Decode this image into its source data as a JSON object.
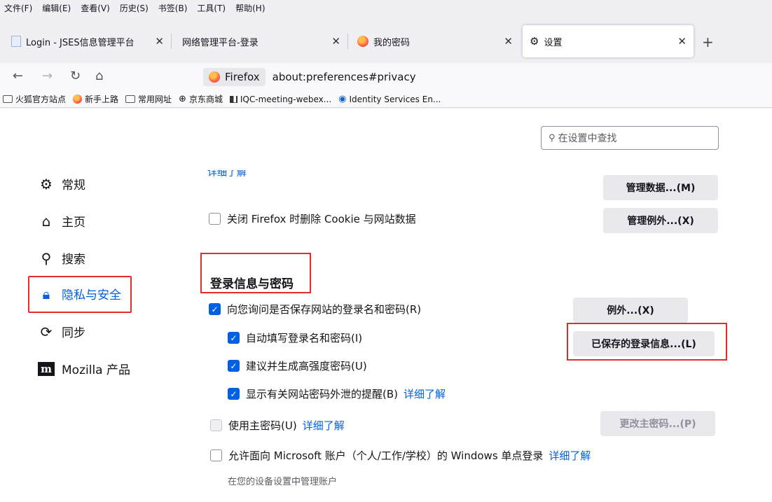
{
  "menubar": {
    "items": [
      "文件(F)",
      "编辑(E)",
      "查看(V)",
      "历史(S)",
      "书签(B)",
      "工具(T)",
      "帮助(H)"
    ]
  },
  "tabs": [
    {
      "title": "Login - JSES信息管理平台",
      "favicon": "page-icon"
    },
    {
      "title": "网络管理平台-登录",
      "favicon": "none"
    },
    {
      "title": "我的密码",
      "favicon": "firefox-icon"
    },
    {
      "title": "设置",
      "favicon": "gear-icon",
      "active": true
    }
  ],
  "newtab_label": "+",
  "navbar": {
    "identity_label": "Firefox",
    "url": "about:preferences#privacy"
  },
  "bookmarks": [
    {
      "label": "火狐官方站点",
      "icon": "folder-icon"
    },
    {
      "label": "新手上路",
      "icon": "firefox-icon"
    },
    {
      "label": "常用网址",
      "icon": "folder-icon"
    },
    {
      "label": "京东商城",
      "icon": "globe-icon"
    },
    {
      "label": "IQC-meeting-webex...",
      "icon": "webex-icon"
    },
    {
      "label": "Identity Services En...",
      "icon": "ise-icon"
    }
  ],
  "search": {
    "placeholder": "在设置中查找"
  },
  "categories": [
    {
      "label": "常规",
      "icon": "gear-icon"
    },
    {
      "label": "主页",
      "icon": "home-icon"
    },
    {
      "label": "搜索",
      "icon": "search-icon"
    },
    {
      "label": "隐私与安全",
      "icon": "lock-icon",
      "selected": true
    },
    {
      "label": "同步",
      "icon": "sync-icon"
    },
    {
      "label": "Mozilla 产品",
      "icon": "mozilla-icon"
    }
  ],
  "cookies": {
    "learn_more_cut": "详细了解",
    "manage_data_btn": "管理数据...(M)",
    "clear_on_close": "关闭 Firefox 时删除 Cookie 与网站数据",
    "manage_exceptions_btn": "管理例外...(X)"
  },
  "logins": {
    "title": "登录信息与密码",
    "ask_to_save": "向您询问是否保存网站的登录名和密码(R)",
    "exceptions_btn": "例外...(X)",
    "autofill": "自动填写登录名和密码(I)",
    "saved_logins_btn": "已保存的登录信息...(L)",
    "suggest_strong": "建议并生成高强度密码(U)",
    "breach_alerts": "显示有关网站密码外泄的提醒(B)",
    "breach_learn_more": "详细了解",
    "primary_password": "使用主密码(U)",
    "primary_learn_more": "详细了解",
    "change_primary_btn": "更改主密码...(P)",
    "windows_sso": "允许面向 Microsoft 账户（个人/工作/学校）的 Windows 单点登录",
    "windows_sso_learn_more": "详细了解",
    "windows_sso_note": "在您的设备设置中管理账户"
  }
}
